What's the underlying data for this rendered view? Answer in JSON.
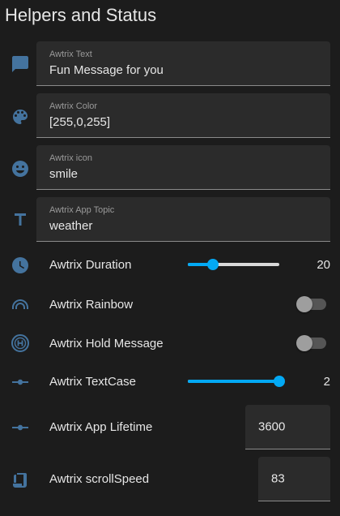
{
  "card": {
    "title": "Helpers and Status"
  },
  "colors": {
    "icon": "#44739e",
    "accent": "#03a9f4",
    "background": "#1c1c1c",
    "field": "#2b2b2b"
  },
  "text_fields": [
    {
      "label": "Awtrix Text",
      "value": "Fun Message for you",
      "icon": "message-icon"
    },
    {
      "label": "Awtrix Color",
      "value": "[255,0,255]",
      "icon": "palette-icon"
    },
    {
      "label": "Awtrix icon",
      "value": "smile",
      "icon": "emoticon-icon"
    },
    {
      "label": "Awtrix App Topic",
      "value": "weather",
      "icon": "format-text-icon"
    }
  ],
  "duration": {
    "label": "Awtrix Duration",
    "value": "20",
    "fraction": 0.27,
    "icon": "clock-icon"
  },
  "rainbow": {
    "label": "Awtrix Rainbow",
    "on": false,
    "icon": "rainbow-icon"
  },
  "hold": {
    "label": "Awtrix Hold Message",
    "on": false,
    "icon": "hold-circle-icon"
  },
  "textcase": {
    "label": "Awtrix TextCase",
    "value": "2",
    "fraction": 1.0,
    "icon": "ray-vertex-icon"
  },
  "lifetime": {
    "label": "Awtrix App Lifetime",
    "value": "3600",
    "icon": "ray-vertex-icon"
  },
  "scrollspeed": {
    "label": "Awtrix scrollSpeed",
    "value": "83",
    "icon": "script-icon"
  }
}
